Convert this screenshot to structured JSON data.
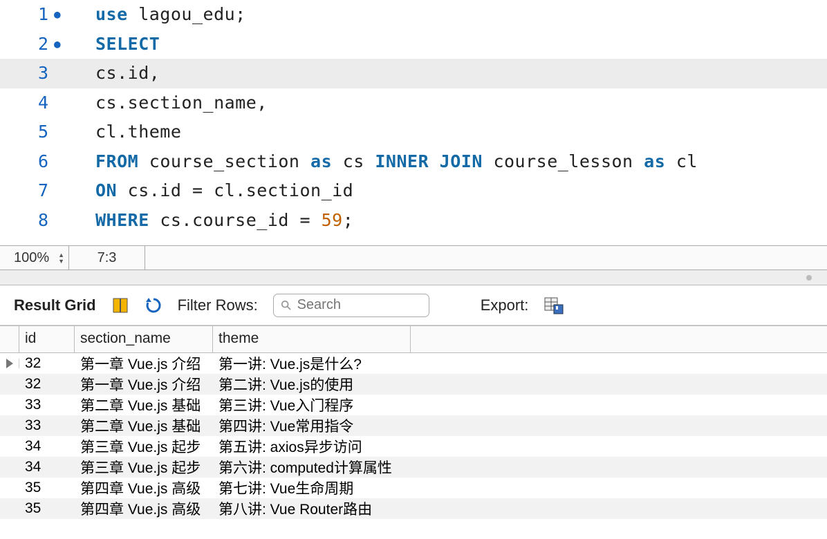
{
  "editor": {
    "lines": [
      {
        "num": "1",
        "bullet": "●",
        "seg": [
          {
            "c": "kw",
            "t": "use"
          },
          {
            "c": "txt",
            "t": " lagou_edu;"
          }
        ]
      },
      {
        "num": "2",
        "bullet": "●",
        "seg": [
          {
            "c": "kw",
            "t": "SELECT"
          }
        ]
      },
      {
        "num": "3",
        "bullet": "",
        "hl": true,
        "seg": [
          {
            "c": "txt",
            "t": "cs.id,"
          }
        ]
      },
      {
        "num": "4",
        "bullet": "",
        "seg": [
          {
            "c": "txt",
            "t": "cs.section_name,"
          }
        ]
      },
      {
        "num": "5",
        "bullet": "",
        "seg": [
          {
            "c": "txt",
            "t": "cl.theme"
          }
        ]
      },
      {
        "num": "6",
        "bullet": "",
        "seg": [
          {
            "c": "kw",
            "t": "FROM"
          },
          {
            "c": "txt",
            "t": " course_section "
          },
          {
            "c": "kw",
            "t": "as"
          },
          {
            "c": "txt",
            "t": " cs "
          },
          {
            "c": "kw",
            "t": "INNER JOIN"
          },
          {
            "c": "txt",
            "t": " course_lesson "
          },
          {
            "c": "kw",
            "t": "as"
          },
          {
            "c": "txt",
            "t": " cl"
          }
        ]
      },
      {
        "num": "7",
        "bullet": "",
        "seg": [
          {
            "c": "kw",
            "t": "ON"
          },
          {
            "c": "txt",
            "t": " cs.id = cl.section_id"
          }
        ]
      },
      {
        "num": "8",
        "bullet": "",
        "seg": [
          {
            "c": "kw",
            "t": "WHERE"
          },
          {
            "c": "txt",
            "t": " cs.course_id = "
          },
          {
            "c": "num",
            "t": "59"
          },
          {
            "c": "txt",
            "t": ";"
          }
        ]
      }
    ]
  },
  "statusbar": {
    "zoom": "100%",
    "cursor": "7:3"
  },
  "toolbar": {
    "title": "Result Grid",
    "filter_label": "Filter Rows:",
    "search_placeholder": "Search",
    "export_label": "Export:"
  },
  "grid": {
    "columns": [
      "id",
      "section_name",
      "theme"
    ],
    "rows": [
      {
        "marker": true,
        "id": "32",
        "section_name": "第一章 Vue.js 介绍",
        "theme": "第一讲: Vue.js是什么?"
      },
      {
        "id": "32",
        "section_name": "第一章 Vue.js 介绍",
        "theme": "第二讲: Vue.js的使用"
      },
      {
        "id": "33",
        "section_name": "第二章 Vue.js 基础",
        "theme": "第三讲: Vue入门程序"
      },
      {
        "id": "33",
        "section_name": "第二章 Vue.js 基础",
        "theme": "第四讲: Vue常用指令"
      },
      {
        "id": "34",
        "section_name": "第三章 Vue.js 起步",
        "theme": "第五讲: axios异步访问"
      },
      {
        "id": "34",
        "section_name": "第三章 Vue.js 起步",
        "theme": "第六讲: computed计算属性"
      },
      {
        "id": "35",
        "section_name": "第四章 Vue.js 高级",
        "theme": "第七讲: Vue生命周期"
      },
      {
        "id": "35",
        "section_name": "第四章 Vue.js 高级",
        "theme": "第八讲: Vue Router路由"
      }
    ]
  }
}
